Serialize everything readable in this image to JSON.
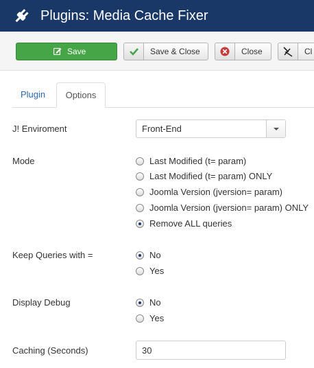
{
  "header": {
    "title": "Plugins: Media Cache Fixer",
    "icon": "plug-icon"
  },
  "toolbar": {
    "save_label": "Save",
    "save_close_label": "Save & Close",
    "close_label": "Close",
    "help_label": "Cl"
  },
  "tabs": [
    {
      "label": "Plugin",
      "active": false
    },
    {
      "label": "Options",
      "active": true
    }
  ],
  "fields": {
    "environment": {
      "label": "J! Enviroment",
      "value": "Front-End"
    },
    "mode": {
      "label": "Mode",
      "options": [
        {
          "label": "Last Modified (t= param)",
          "checked": false
        },
        {
          "label": "Last Modified (t= param) ONLY",
          "checked": false
        },
        {
          "label": "Joomla Version (jversion= param)",
          "checked": false
        },
        {
          "label": "Joomla Version (jversion= param) ONLY",
          "checked": false
        },
        {
          "label": "Remove ALL queries",
          "checked": true
        }
      ]
    },
    "keep_queries": {
      "label": "Keep Queries with =",
      "options": [
        {
          "label": "No",
          "checked": true
        },
        {
          "label": "Yes",
          "checked": false
        }
      ]
    },
    "debug": {
      "label": "Display Debug",
      "options": [
        {
          "label": "No",
          "checked": true
        },
        {
          "label": "Yes",
          "checked": false
        }
      ]
    },
    "caching": {
      "label": "Caching (Seconds)",
      "value": "30"
    }
  },
  "colors": {
    "header_bg": "#1a3867",
    "save_green": "#46a546",
    "link_blue": "#2a69b8",
    "close_red": "#c43a3a"
  }
}
